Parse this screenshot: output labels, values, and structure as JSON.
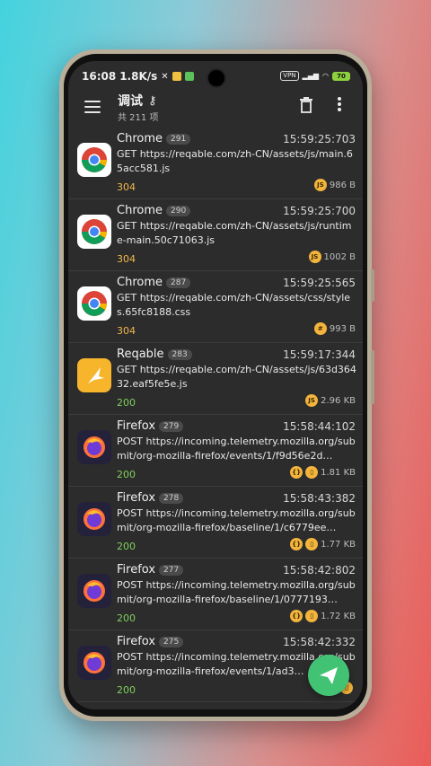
{
  "status_bar": {
    "time": "16:08",
    "speed": "1.8K/s",
    "vpn": "VPN",
    "battery": "70"
  },
  "appbar": {
    "title": "调试",
    "subtitle": "共 211 项"
  },
  "colors": {
    "status_304": "#f0b84c",
    "status_200": "#7fd15a",
    "fab": "#42c374"
  },
  "requests": [
    {
      "app": "Chrome",
      "id": "291",
      "time": "15:59:25:703",
      "method": "GET",
      "url": "https://reqable.com/zh-CN/assets/js/main.65acc581.js",
      "status": "304",
      "type_tags": [
        "JS"
      ],
      "size": "986 B",
      "icon": "chrome-icon"
    },
    {
      "app": "Chrome",
      "id": "290",
      "time": "15:59:25:700",
      "method": "GET",
      "url": "https://reqable.com/zh-CN/assets/js/runtime-main.50c71063.js",
      "status": "304",
      "type_tags": [
        "JS"
      ],
      "size": "1002 B",
      "icon": "chrome-icon"
    },
    {
      "app": "Chrome",
      "id": "287",
      "time": "15:59:25:565",
      "method": "GET",
      "url": "https://reqable.com/zh-CN/assets/css/styles.65fc8188.css",
      "status": "304",
      "type_tags": [
        "#"
      ],
      "size": "993 B",
      "icon": "chrome-icon"
    },
    {
      "app": "Reqable",
      "id": "283",
      "time": "15:59:17:344",
      "method": "GET",
      "url": "https://reqable.com/zh-CN/assets/js/63d36432.eaf5fe5e.js",
      "status": "200",
      "type_tags": [
        "JS"
      ],
      "size": "2.96 KB",
      "icon": "reqable-icon"
    },
    {
      "app": "Firefox",
      "id": "279",
      "time": "15:58:44:102",
      "method": "POST",
      "url": "https://incoming.telemetry.mozilla.org/submit/org-mozilla-firefox/events/1/f9d56e2d…",
      "status": "200",
      "type_tags": [
        "{}",
        "▯"
      ],
      "size": "1.81 KB",
      "icon": "firefox-icon"
    },
    {
      "app": "Firefox",
      "id": "278",
      "time": "15:58:43:382",
      "method": "POST",
      "url": "https://incoming.telemetry.mozilla.org/submit/org-mozilla-firefox/baseline/1/c6779ee…",
      "status": "200",
      "type_tags": [
        "{}",
        "▯"
      ],
      "size": "1.77 KB",
      "icon": "firefox-icon"
    },
    {
      "app": "Firefox",
      "id": "277",
      "time": "15:58:42:802",
      "method": "POST",
      "url": "https://incoming.telemetry.mozilla.org/submit/org-mozilla-firefox/baseline/1/0777193…",
      "status": "200",
      "type_tags": [
        "{}",
        "▯"
      ],
      "size": "1.72 KB",
      "icon": "firefox-icon"
    },
    {
      "app": "Firefox",
      "id": "275",
      "time": "15:58:42:332",
      "method": "POST",
      "url": "https://incoming.telemetry.mozilla.org/submit/org-mozilla-firefox/events/1/ad3…",
      "status": "200",
      "type_tags": [
        "{}",
        "▯"
      ],
      "size": "",
      "icon": "firefox-icon"
    }
  ]
}
